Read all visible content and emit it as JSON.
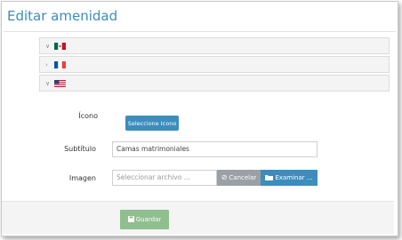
{
  "dialog": {
    "title": "Editar amenidad"
  },
  "languages": [
    {
      "flag": "mexico-flag-icon",
      "expanded": true
    },
    {
      "flag": "france-flag-icon",
      "expanded": false
    },
    {
      "flag": "usa-flag-icon",
      "expanded": true
    }
  ],
  "form": {
    "icon_label": "Ícono",
    "icon_button": "Seleccione Icono",
    "subtitle_label": "Subtítulo",
    "subtitle_value": "Camas matrimoniales",
    "image_label": "Imagen",
    "image_placeholder": "Seleccionar archivo ...",
    "cancel_button": "Cancelar",
    "browse_button": "Examinar ..."
  },
  "footer": {
    "save_button": "Guardar"
  },
  "colors": {
    "accent": "#3c8dbc",
    "save": "#8fbf8f",
    "cancel": "#9aa0a6"
  }
}
